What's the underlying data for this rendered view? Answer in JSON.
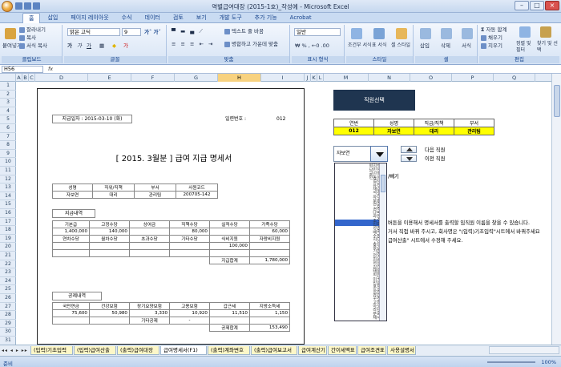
{
  "window": {
    "title": "역별급여대장 (2015-1호)_작성예 - Microsoft Excel"
  },
  "ribbon_tabs": [
    "홈",
    "삽입",
    "페이지 레이아웃",
    "수식",
    "데이터",
    "검토",
    "보기",
    "개발 도구",
    "추가 기능",
    "Acrobat"
  ],
  "ribbon": {
    "paste": "붙여넣기",
    "cut": "잘라내기",
    "copy": "복사",
    "format_painter": "서식 복사",
    "clipboard": "클립보드",
    "font_name": "맑은 고딕",
    "font_size": "9",
    "font_group": "글꼴",
    "wrap_text": "텍스트 줄 바꿈",
    "merge_center": "병합하고 가운데 맞춤",
    "align_group": "맞춤",
    "number_format": "일반",
    "number_group": "표시 형식",
    "cond_format": "조건부 서식",
    "format_table": "표 서식",
    "cell_style": "셀 스타일",
    "style_group": "스타일",
    "insert": "삽입",
    "delete": "삭제",
    "format": "서식",
    "cell_group": "셀",
    "autosum": "자동 합계",
    "fill": "채우기",
    "clear": "지우기",
    "sort_filter": "정렬 및 필터",
    "find_select": "찾기 및 선택",
    "edit_group": "편집"
  },
  "formula_bar": {
    "name_box": "H56",
    "fx": "fx"
  },
  "columns": [
    "A",
    "B",
    "C",
    "D",
    "E",
    "F",
    "G",
    "H",
    "I",
    "J",
    "K",
    "L",
    "M",
    "N",
    "O",
    "P",
    "Q"
  ],
  "selected_column": "H",
  "rows": [
    "1",
    "2",
    "3",
    "4",
    "5",
    "6",
    "7",
    "8",
    "9",
    "10",
    "11",
    "12",
    "13",
    "14",
    "15",
    "16",
    "17",
    "18",
    "19",
    "20",
    "21",
    "22",
    "23",
    "24",
    "25",
    "26",
    "27",
    "28",
    "29",
    "30",
    "31"
  ],
  "slip": {
    "pay_date": "지급일자 : 2015-03-10 (화)",
    "serial_label": "일련번호 :",
    "serial_no": "012",
    "title": "[ 2015. 3월분 ]  급여 지급 명세서",
    "emp_headers": [
      "성명",
      "직위/직책",
      "부서",
      "사원코드"
    ],
    "emp_values": [
      "자보연",
      "대리",
      "관리팀",
      "200705-142"
    ],
    "pay_section": "지급내역",
    "pay_headers1": [
      "기본급",
      "고정수당",
      "상여금",
      "직책수당",
      "실적수당",
      "가족수당"
    ],
    "pay_values1": [
      "1,400,000",
      "140,000",
      "",
      "80,000",
      "",
      "60,000"
    ],
    "pay_headers2": [
      "연차수당",
      "월차수당",
      "초과수당",
      "기타수당",
      "식비지원",
      "자랑비지원"
    ],
    "pay_values2": [
      "",
      "",
      "",
      "",
      "100,000",
      ""
    ],
    "pay_total_label": "지급합계",
    "pay_total": "1,780,000",
    "ded_section": "공제내역",
    "ded_headers": [
      "국민연금",
      "건강보험",
      "장기요양보험",
      "고용보험",
      "갑근세",
      "지방소득세"
    ],
    "ded_values": [
      "75,600",
      "50,980",
      "3,330",
      "10,920",
      "11,510",
      "1,150"
    ],
    "ded_other_label": "기타공제",
    "ded_other_value": "-",
    "ded_total_label": "공제합계",
    "ded_total": "153,490"
  },
  "selector": {
    "button": "직원선택",
    "headers": [
      "연번",
      "성명",
      "직급/직책",
      "부서"
    ],
    "values": [
      "012",
      "자보연",
      "대리",
      "관리팀"
    ],
    "combo_value": "자보연",
    "next": "다음 직원",
    "prev": "이전 직원",
    "partial_label": "/빼기",
    "list_items": "백지영 이재현 김수진 홍길동 박민수 최영희 정다은 강민호 윤서연 장현우 임지훈 한예슬 오세훈 서지민 신동엽 유재석 자보연 권나라 조인성 배수지 송중기 전지현 김태희 이민호 하정우 고아라 문채원 남궁민",
    "info1": "버튼을 이용해서 명세서를 출력할 임직원 이름을 찾을 수 있습니다.",
    "info2": "거서 직접 바꿔 주시고, 회사명은 \"(입력)기초입력\"시트에서 바꿔주세요",
    "info3": "급여산출\" 시트에서 수정해 주세요."
  },
  "sheet_tabs": [
    "(입력)기초입력",
    "(입력)급여산출",
    "(출력)급여대장",
    "급여명세서(F1)",
    "(출력)계좌변호",
    "(출력)급여보고서",
    "급여계산기",
    "간이세액표",
    "급여조견표",
    "사용설명서"
  ],
  "active_tab": "급여명세서(F1)",
  "status": {
    "ready": "준비",
    "zoom": "100%"
  }
}
